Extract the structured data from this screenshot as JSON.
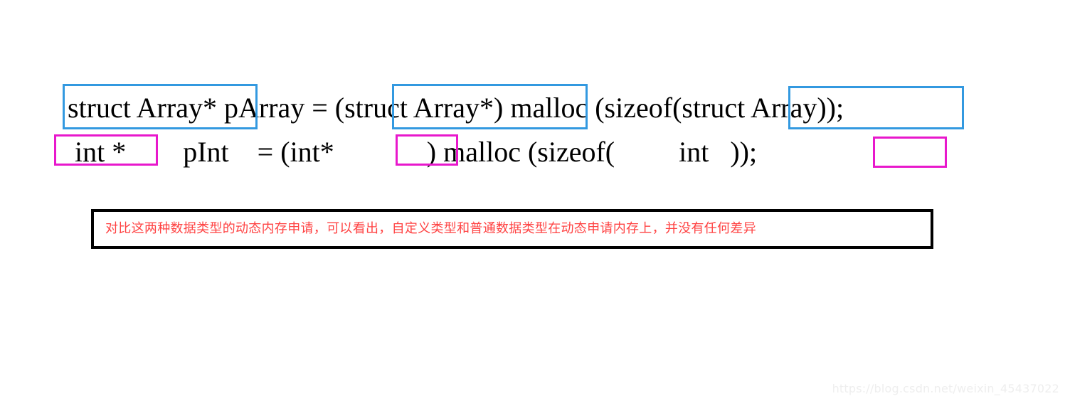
{
  "code": {
    "line1": {
      "full_text": "struct Array* pArray = (struct Array*) malloc (sizeof(struct Array));",
      "seg_type": "struct Array*",
      "seg_gap1": " ",
      "seg_var": "pArray = ",
      "seg_cast": "(struct Array*)",
      "seg_mid": " malloc (sizeof(",
      "seg_sizeof_arg": "struct Array",
      "seg_tail": "));"
    },
    "line2": {
      "full_text": "int *        pInt    = (int*              ) malloc (sizeof(        int   ));",
      "seg_type": " int *  ",
      "seg_gap1": "      ",
      "seg_var": "pInt    = ",
      "seg_paren_open": "(",
      "seg_cast": "int*",
      "seg_gap2": "             ",
      "seg_mid": ") malloc (sizeof(",
      "seg_gap3": "        ",
      "seg_sizeof_arg": " int ",
      "seg_gap4": "  ",
      "seg_tail": "));"
    }
  },
  "highlights": {
    "blue_color": "#3399e0",
    "magenta_color": "#e818cc",
    "blue_boxes": [
      {
        "label": "struct Array*",
        "target": "declaration-type"
      },
      {
        "label": "(struct Array*)",
        "target": "cast-type"
      },
      {
        "label": "struct Array",
        "target": "sizeof-argument"
      }
    ],
    "magenta_boxes": [
      {
        "label": "int *",
        "target": "declaration-type"
      },
      {
        "label": "int*",
        "target": "cast-type"
      },
      {
        "label": "int",
        "target": "sizeof-argument"
      }
    ]
  },
  "note": {
    "text": "对比这两种数据类型的动态内存申请，可以看出，自定义类型和普通数据类型在动态申请内存上，并没有任何差异",
    "text_color": "#ff4242",
    "border_color": "#000000"
  },
  "watermark": {
    "text": "https://blog.csdn.net/weixin_45437022"
  }
}
